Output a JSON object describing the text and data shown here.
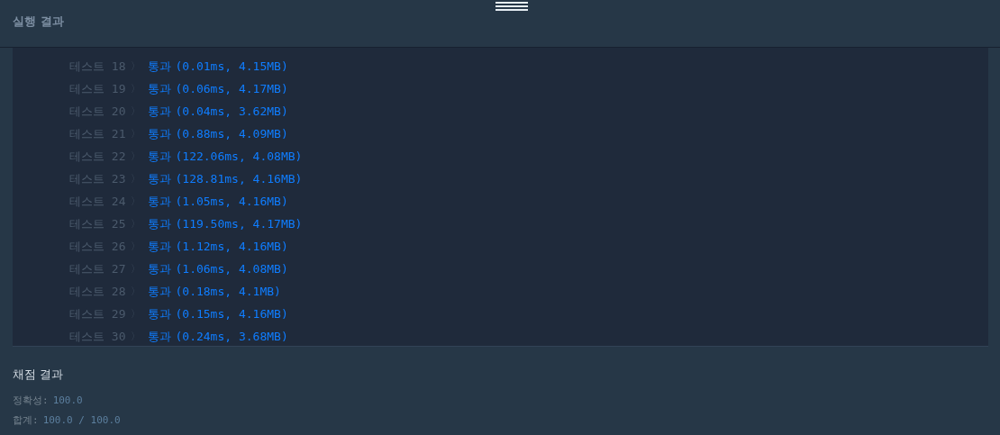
{
  "header": {
    "title": "실행 결과"
  },
  "results": [
    {
      "label": "테스트 18",
      "chevron": "〉",
      "status": "통과",
      "detail": "(0.01ms, 4.15MB)"
    },
    {
      "label": "테스트 19",
      "chevron": "〉",
      "status": "통과",
      "detail": "(0.06ms, 4.17MB)"
    },
    {
      "label": "테스트 20",
      "chevron": "〉",
      "status": "통과",
      "detail": "(0.04ms, 3.62MB)"
    },
    {
      "label": "테스트 21",
      "chevron": "〉",
      "status": "통과",
      "detail": "(0.88ms, 4.09MB)"
    },
    {
      "label": "테스트 22",
      "chevron": "〉",
      "status": "통과",
      "detail": "(122.06ms, 4.08MB)"
    },
    {
      "label": "테스트 23",
      "chevron": "〉",
      "status": "통과",
      "detail": "(128.81ms, 4.16MB)"
    },
    {
      "label": "테스트 24",
      "chevron": "〉",
      "status": "통과",
      "detail": "(1.05ms, 4.16MB)"
    },
    {
      "label": "테스트 25",
      "chevron": "〉",
      "status": "통과",
      "detail": "(119.50ms, 4.17MB)"
    },
    {
      "label": "테스트 26",
      "chevron": "〉",
      "status": "통과",
      "detail": "(1.12ms, 4.16MB)"
    },
    {
      "label": "테스트 27",
      "chevron": "〉",
      "status": "통과",
      "detail": "(1.06ms, 4.08MB)"
    },
    {
      "label": "테스트 28",
      "chevron": "〉",
      "status": "통과",
      "detail": "(0.18ms, 4.1MB)"
    },
    {
      "label": "테스트 29",
      "chevron": "〉",
      "status": "통과",
      "detail": "(0.15ms, 4.16MB)"
    },
    {
      "label": "테스트 30",
      "chevron": "〉",
      "status": "통과",
      "detail": "(0.24ms, 3.68MB)"
    }
  ],
  "score": {
    "title": "채점 결과",
    "lines": [
      {
        "label": "정확성:",
        "value": "100.0"
      },
      {
        "label": "합계:",
        "value": "100.0 / 100.0"
      }
    ]
  }
}
